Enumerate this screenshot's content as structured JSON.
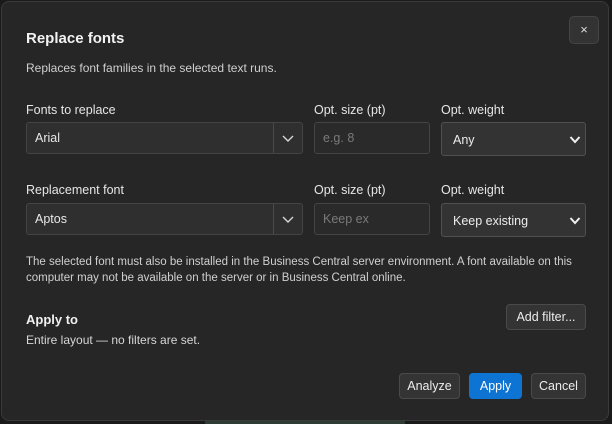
{
  "dialog": {
    "title": "Replace fonts",
    "subtitle": "Replaces font families in the selected text runs.",
    "close_label": "×"
  },
  "fonts_to_replace": {
    "label": "Fonts to replace",
    "font_value": "Arial",
    "size_label": "Opt. size (pt)",
    "size_placeholder": "e.g. 8",
    "weight_label": "Opt. weight",
    "weight_value": "Any"
  },
  "replacement": {
    "label": "Replacement font",
    "font_value": "Aptos",
    "size_label": "Opt. size (pt)",
    "size_placeholder": "Keep ex",
    "weight_label": "Opt. weight",
    "weight_value": "Keep existing"
  },
  "note": "The selected font must also be installed in the Business Central server environment. A font available on this computer may not be available on the server or in Business Central online.",
  "apply_to": {
    "title": "Apply to",
    "description": "Entire layout — no filters are set.",
    "add_filter_label": "Add filter..."
  },
  "footer": {
    "analyze_label": "Analyze",
    "apply_label": "Apply",
    "cancel_label": "Cancel"
  },
  "icons": {
    "dropdown": "chevron-down-icon",
    "close": "close-icon"
  },
  "colors": {
    "primary_button": "#0e74d3",
    "dialog_background": "#262626"
  }
}
